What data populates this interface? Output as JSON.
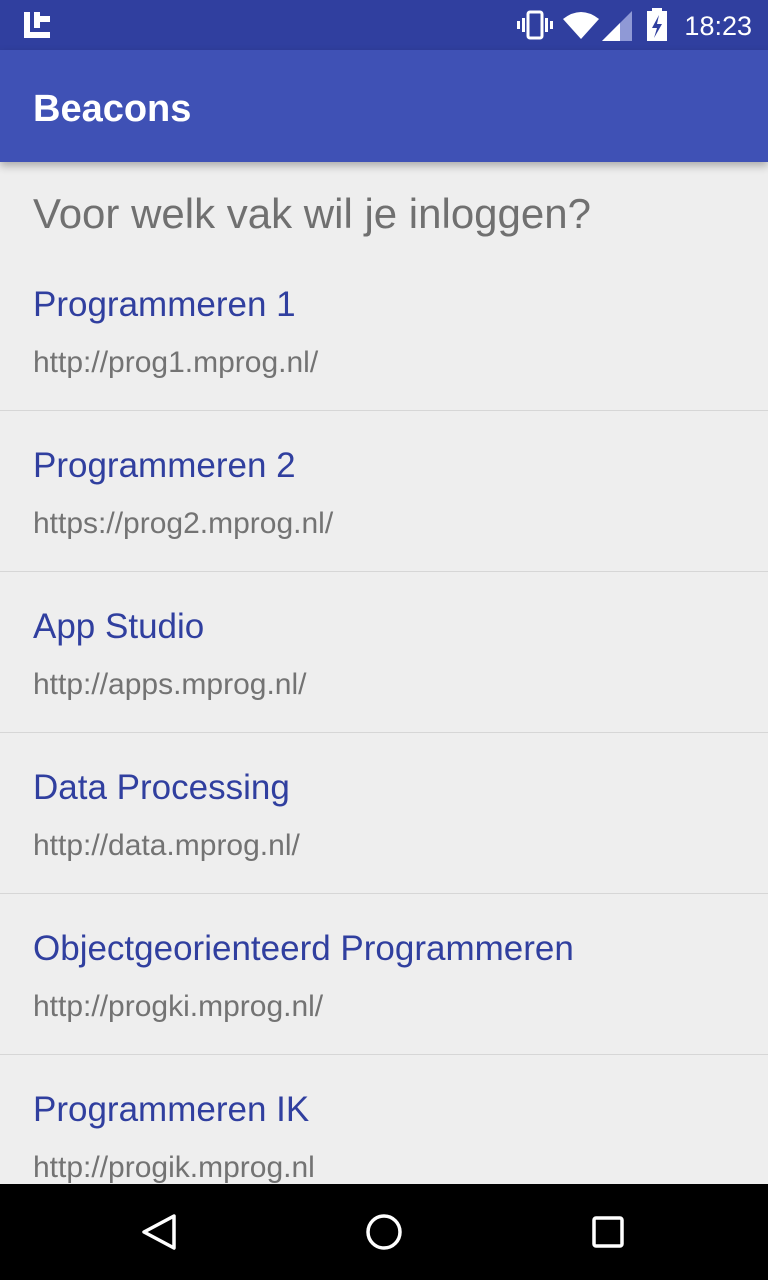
{
  "status_bar": {
    "time": "18:23",
    "icons": [
      "app-notification-icon",
      "vibrate-icon",
      "wifi-icon",
      "signal-icon",
      "battery-charging-icon"
    ]
  },
  "app_bar": {
    "title": "Beacons",
    "color": "#3f51b5",
    "status_color": "#303f9f"
  },
  "main": {
    "prompt": "Voor welk vak wil je inloggen?",
    "items": [
      {
        "name": "Programmeren 1",
        "url": "http://prog1.mprog.nl/"
      },
      {
        "name": "Programmeren 2",
        "url": "https://prog2.mprog.nl/"
      },
      {
        "name": "App Studio",
        "url": "http://apps.mprog.nl/"
      },
      {
        "name": "Data Processing",
        "url": "http://data.mprog.nl/"
      },
      {
        "name": "Objectgeorienteerd Programmeren",
        "url": "http://progki.mprog.nl/"
      },
      {
        "name": "Programmeren IK",
        "url": "http://progik.mprog.nl"
      }
    ]
  },
  "nav_bar": {
    "icons": [
      "back-icon",
      "home-icon",
      "recents-icon"
    ]
  }
}
